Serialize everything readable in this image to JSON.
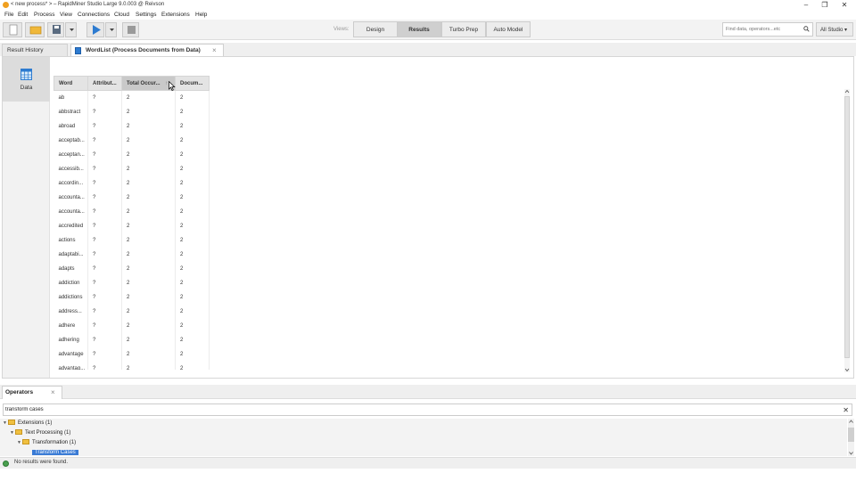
{
  "window": {
    "title": "< new process* > – RapidMiner Studio Large 9.0.003 @ Reivson",
    "minimize": "–",
    "maximize": "❐",
    "close": "✕"
  },
  "menu": [
    "File",
    "Edit",
    "Process",
    "View",
    "Connections",
    "Cloud",
    "Settings",
    "Extensions",
    "Help"
  ],
  "toolbar": {
    "views_label": "Views:",
    "views": [
      "Design",
      "Results",
      "Turbo Prep",
      "Auto Model"
    ],
    "active_view": "Results",
    "search_placeholder": "Find data, operators...etc",
    "scope": "All Studio ▾"
  },
  "tabs": {
    "result_history": "Result History",
    "wordlist": "WordList (Process Documents from Data)",
    "close": "×"
  },
  "side": {
    "data_label": "Data"
  },
  "table": {
    "headers": [
      "Word",
      "Attribut...",
      "Total Occur...",
      "Docum..."
    ],
    "sort_indicator": "↑",
    "rows": [
      [
        "ab",
        "?",
        "2",
        "2"
      ],
      [
        "abbstract",
        "?",
        "2",
        "2"
      ],
      [
        "abroad",
        "?",
        "2",
        "2"
      ],
      [
        "acceptab...",
        "?",
        "2",
        "2"
      ],
      [
        "acceptan...",
        "?",
        "2",
        "2"
      ],
      [
        "accessib...",
        "?",
        "2",
        "2"
      ],
      [
        "accordin...",
        "?",
        "2",
        "2"
      ],
      [
        "accounta...",
        "?",
        "2",
        "2"
      ],
      [
        "accounta...",
        "?",
        "2",
        "2"
      ],
      [
        "accredited",
        "?",
        "2",
        "2"
      ],
      [
        "actions",
        "?",
        "2",
        "2"
      ],
      [
        "adaptabi...",
        "?",
        "2",
        "2"
      ],
      [
        "adapts",
        "?",
        "2",
        "2"
      ],
      [
        "addiction",
        "?",
        "2",
        "2"
      ],
      [
        "addictions",
        "?",
        "2",
        "2"
      ],
      [
        "address...",
        "?",
        "2",
        "2"
      ],
      [
        "adhere",
        "?",
        "2",
        "2"
      ],
      [
        "adhering",
        "?",
        "2",
        "2"
      ],
      [
        "advantage",
        "?",
        "2",
        "2"
      ],
      [
        "advantag...",
        "?",
        "2",
        "2"
      ]
    ]
  },
  "operators": {
    "tab_label": "Operators",
    "close": "×",
    "search_value": "transform cases",
    "clear": "✕",
    "tree": [
      {
        "label": "Extensions (1)"
      },
      {
        "label": "Text Processing (1)"
      },
      {
        "label": "Transformation (1)"
      },
      {
        "label": "Transform Cases"
      }
    ]
  },
  "status": {
    "text": "No results were found."
  },
  "colors": {
    "accent": "#3a7bd5",
    "sorted_header": "#c9c9c9",
    "selected_side": "#dcdcdc"
  }
}
